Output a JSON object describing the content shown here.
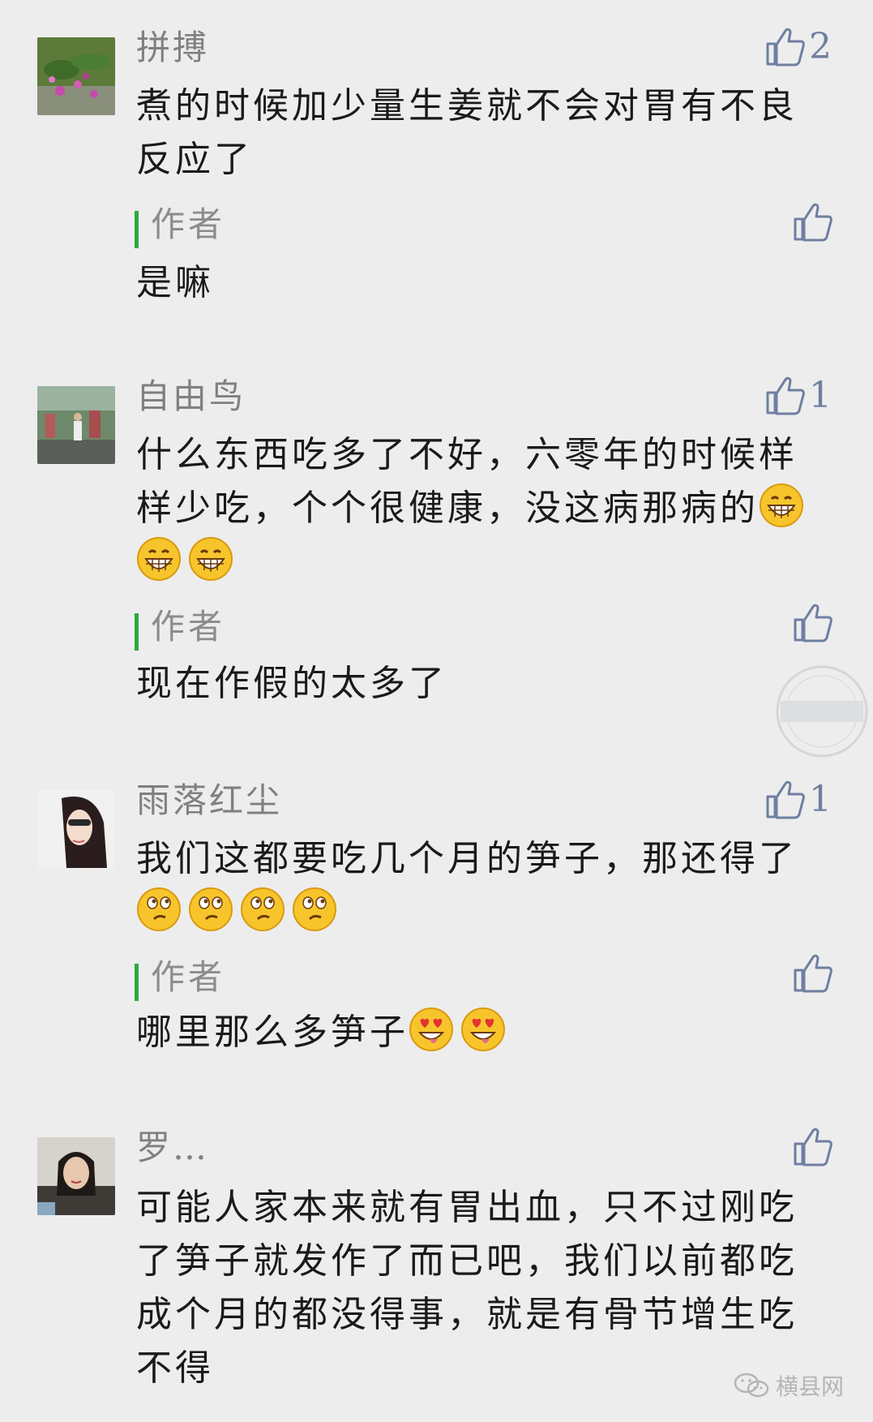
{
  "comments": [
    {
      "username": "拼搏",
      "likes": "2",
      "content": "煮的时候加少量生姜就不会对胃有不良反应了",
      "reply_label": "作者",
      "reply_text": "是嘛"
    },
    {
      "username": "自由鸟",
      "likes": "1",
      "content": "什么东西吃多了不好，六零年的时候样样少吃，个个很健康，没这病那病的",
      "reply_label": "作者",
      "reply_text": "现在作假的太多了"
    },
    {
      "username": "雨落红尘",
      "likes": "1",
      "content": "我们这都要吃几个月的笋子，那还得了",
      "reply_label": "作者",
      "reply_text": "哪里那么多笋子"
    },
    {
      "username": "罗…",
      "likes": "",
      "content": "可能人家本来就有胃出血，只不过刚吃了笋子就发作了而已吧，我们以前都吃成个月的都没得事，就是有骨节增生吃不得"
    }
  ],
  "emoji": {
    "grin": "grin-emoji",
    "puzzled": "puzzled-emoji",
    "love": "heart-eyes-emoji"
  },
  "footer": {
    "brand": "横县网"
  },
  "colors": {
    "background": "#ededed",
    "like_icon": "#6f7fa1",
    "reply_bar": "#2ba93b",
    "username": "#808080"
  }
}
